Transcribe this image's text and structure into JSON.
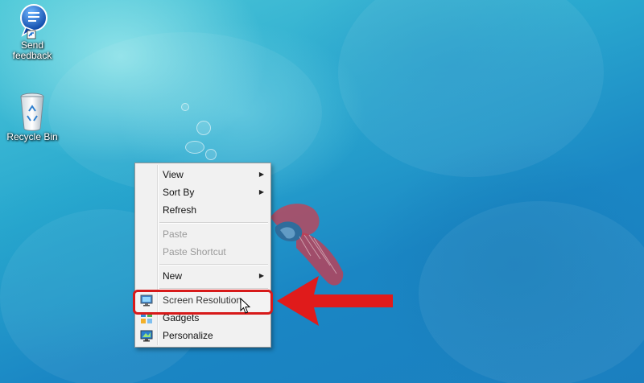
{
  "desktop": {
    "icons": [
      {
        "label_line1": "Send",
        "label_line2": "feedback",
        "icon": "send-feedback-icon"
      },
      {
        "label": "Recycle Bin",
        "icon": "recycle-bin-icon"
      }
    ],
    "wallpaper": {
      "colors": {
        "primary": "#1a86c4",
        "light": "#4fc9d8"
      }
    }
  },
  "context_menu": {
    "items": [
      {
        "label": "View",
        "submenu": true
      },
      {
        "label": "Sort By",
        "submenu": true
      },
      {
        "label": "Refresh"
      },
      {
        "label": "Paste",
        "disabled": true
      },
      {
        "label": "Paste Shortcut",
        "disabled": true
      },
      {
        "label": "New",
        "submenu": true
      },
      {
        "label": "Screen Resolution",
        "icon": "monitor-icon",
        "highlighted": true
      },
      {
        "label": "Gadgets",
        "icon": "gadgets-icon"
      },
      {
        "label": "Personalize",
        "icon": "personalize-icon"
      }
    ],
    "submenu_glyph": "▶"
  },
  "annotation": {
    "highlight_color": "#d71a1a",
    "arrow_color": "#e01b1b"
  }
}
